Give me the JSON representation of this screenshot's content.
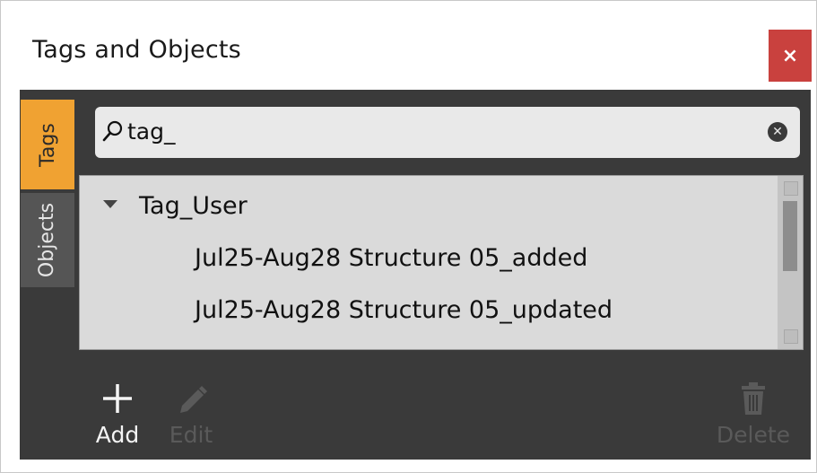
{
  "window": {
    "title": "Tags and Objects",
    "close_label": "×"
  },
  "tabs": [
    {
      "label": "Tags",
      "active": true
    },
    {
      "label": "Objects",
      "active": false
    }
  ],
  "search": {
    "value": "tag_",
    "icon": "search-icon",
    "clear_icon": "clear-icon"
  },
  "tree": {
    "group": {
      "label": "Tag_User",
      "expanded": true
    },
    "items": [
      "Jul25-Aug28 Structure 05_added",
      "Jul25-Aug28 Structure 05_updated"
    ]
  },
  "actions": {
    "add": {
      "label": "Add",
      "icon": "plus-icon",
      "enabled": true
    },
    "edit": {
      "label": "Edit",
      "icon": "pencil-icon",
      "enabled": false
    },
    "delete": {
      "label": "Delete",
      "icon": "trash-icon",
      "enabled": false
    }
  },
  "colors": {
    "active_tab": "#f0a232",
    "close_button": "#c9413e",
    "panel_bg": "#3a3a3a"
  }
}
